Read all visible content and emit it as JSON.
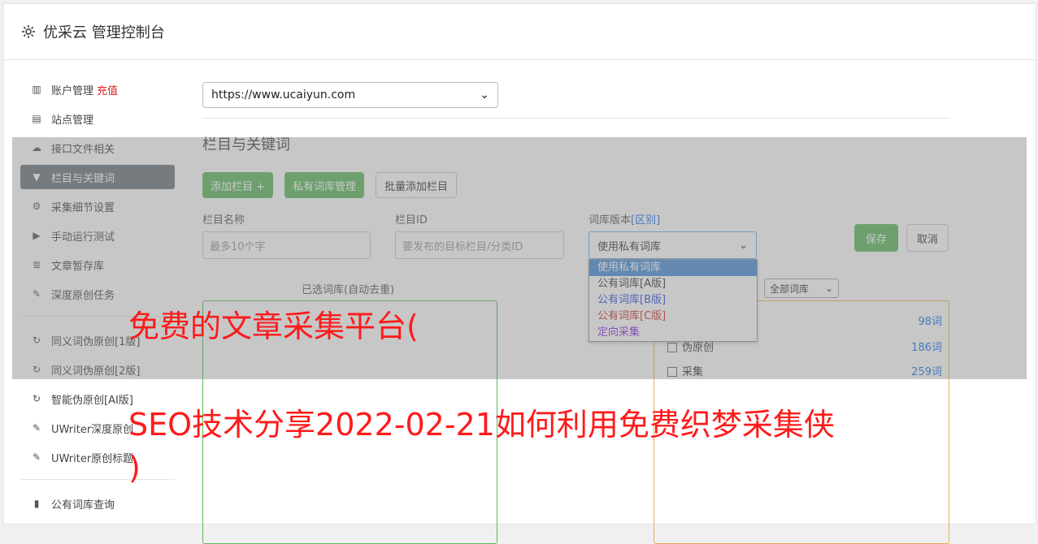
{
  "app": {
    "title": "优采云 管理控制台",
    "icon": "gear-icon"
  },
  "sidebar": {
    "items": [
      {
        "label": "账户管理",
        "extra": "充值",
        "icon": "bar-chart-icon"
      },
      {
        "label": "站点管理",
        "icon": "server-icon"
      },
      {
        "label": "接口文件相关",
        "icon": "cloud-upload-icon"
      },
      {
        "label": "栏目与关键词",
        "icon": "filter-icon",
        "active": true
      },
      {
        "label": "采集细节设置",
        "icon": "cogs-icon"
      },
      {
        "label": "手动运行测试",
        "icon": "play-circle-icon"
      },
      {
        "label": "文章暂存库",
        "icon": "database-icon"
      },
      {
        "label": "深度原创任务",
        "icon": "edit-icon"
      },
      {
        "label": "同义词伪原创[1版]",
        "icon": "refresh-icon"
      },
      {
        "label": "同义词伪原创[2版]",
        "icon": "refresh-icon"
      },
      {
        "label": "智能伪原创[AI版]",
        "icon": "refresh-icon"
      },
      {
        "label": "UWriter深度原创",
        "icon": "edit-icon"
      },
      {
        "label": "UWriter原创标题",
        "icon": "edit-icon"
      },
      {
        "label": "公有词库查询",
        "icon": "book-icon"
      }
    ]
  },
  "main": {
    "site_select": "https://www.ucaiyun.com",
    "section_title": "栏目与关键词",
    "buttons": {
      "add_column": "添加栏目 +",
      "private_lib": "私有词库管理",
      "batch_add": "批量添加栏目"
    },
    "form": {
      "name_label": "栏目名称",
      "name_placeholder": "最多10个字",
      "id_label": "栏目ID",
      "id_placeholder": "要发布的目标栏目/分类ID",
      "version_label": "词库版本",
      "version_link": "[区别]",
      "version_value": "使用私有词库",
      "save": "保存",
      "cancel": "取消"
    },
    "dropdown_options": [
      "使用私有词库",
      "公有词库[A版]",
      "公有词库[B版]",
      "公有词库[C版]",
      "定向采集"
    ],
    "selected_title": "已选词库(自动去重)",
    "filter_select": "全部词库",
    "libs": [
      {
        "name": "",
        "count": "98词"
      },
      {
        "name": "伪原创",
        "count": "186词"
      },
      {
        "name": "采集",
        "count": "259词"
      }
    ]
  },
  "overlay_text": {
    "line1": "免费的文章采集平台(",
    "line2": "SEO技术分享2022-02-21如何利用免费织梦采集侠",
    "line3": ")"
  }
}
